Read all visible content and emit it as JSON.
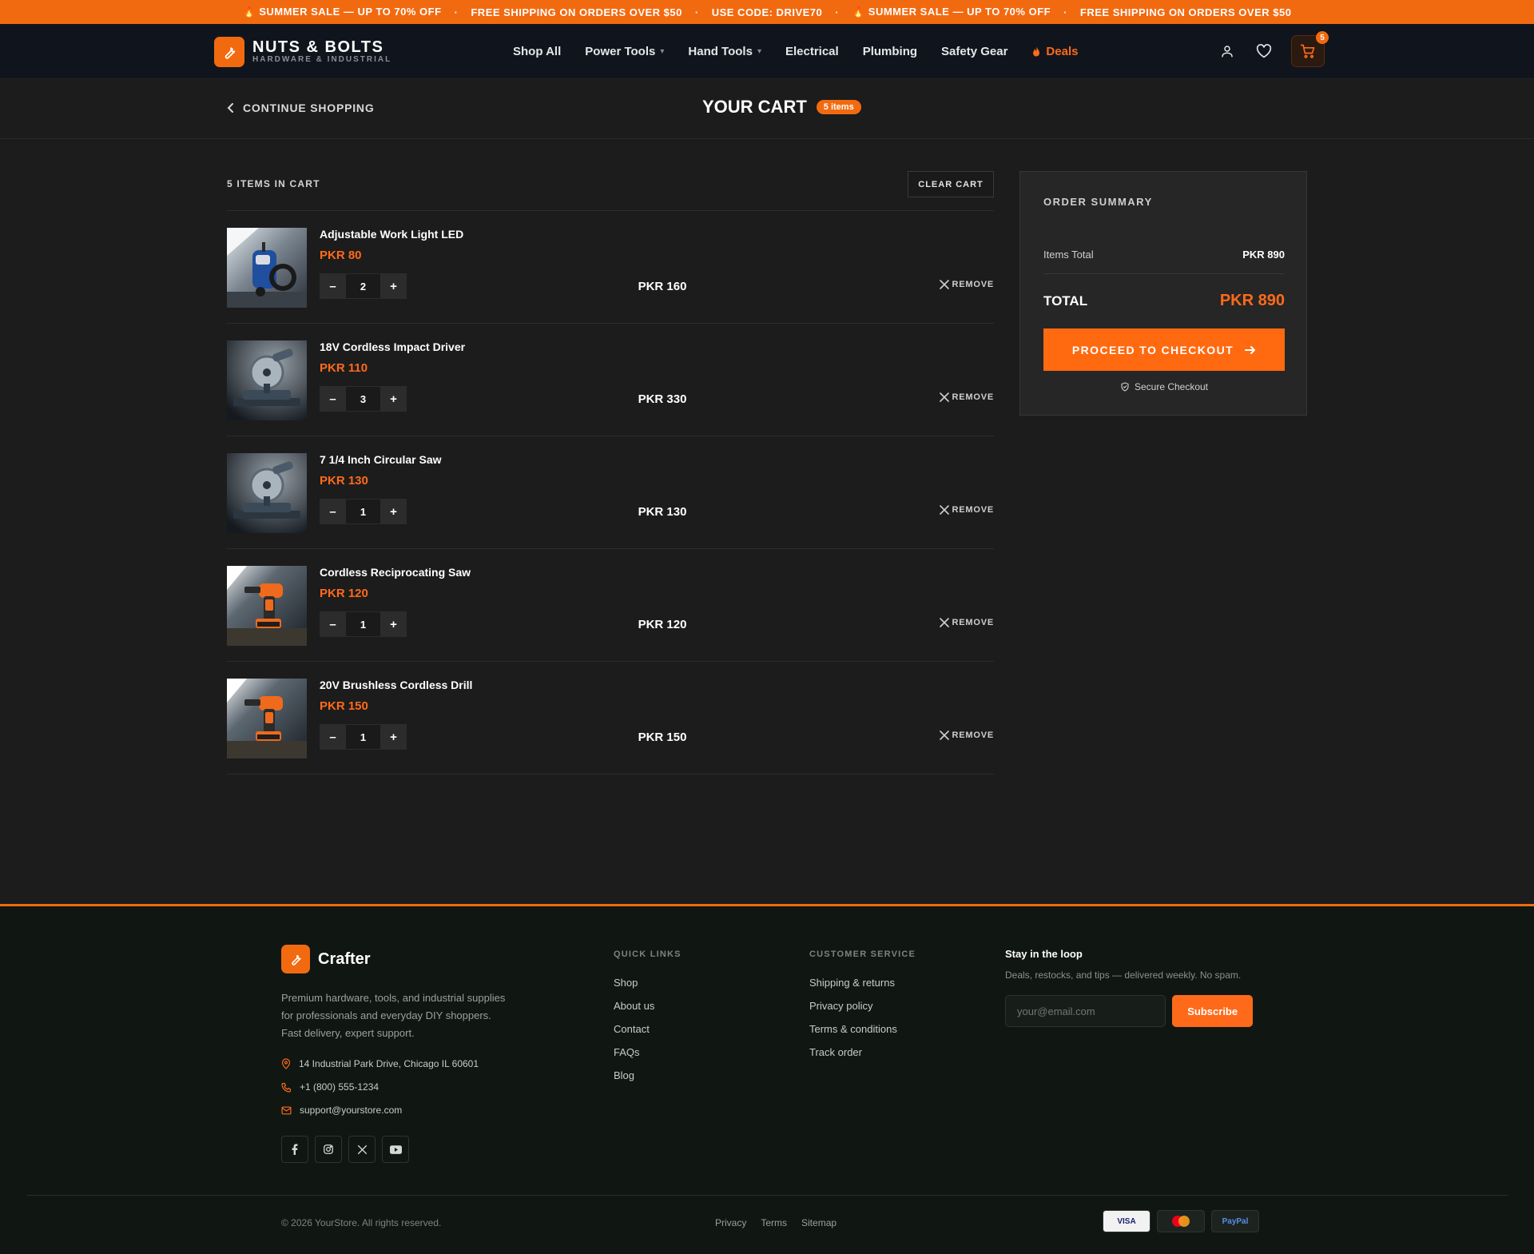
{
  "promo": {
    "items": [
      "SUMMER SALE — UP TO 70% OFF",
      "FREE SHIPPING ON ORDERS OVER $50",
      "USE CODE: DRIVE70",
      "SUMMER SALE — UP TO 70% OFF",
      "FREE SHIPPING ON ORDERS OVER $50"
    ]
  },
  "brand": {
    "name": "NUTS & BOLTS",
    "tagline": "HARDWARE & INDUSTRIAL"
  },
  "nav": {
    "items": [
      "Shop All",
      "Power Tools",
      "Hand Tools",
      "Electrical",
      "Plumbing",
      "Safety Gear",
      "Deals"
    ]
  },
  "header": {
    "cart_count": "5"
  },
  "cart": {
    "continue_label": "CONTINUE SHOPPING",
    "title": "YOUR CART",
    "badge": "5 items",
    "items_label": "5 ITEMS IN CART",
    "clear_label": "CLEAR CART",
    "remove_label": "REMOVE",
    "items": [
      {
        "name": "Adjustable Work Light LED",
        "price": "PKR 80",
        "qty": "2",
        "total": "PKR 160",
        "image": "pressure-washer"
      },
      {
        "name": "18V Cordless Impact Driver",
        "price": "PKR 110",
        "qty": "3",
        "total": "PKR 330",
        "image": "miter-saw"
      },
      {
        "name": "7 1/4 Inch Circular Saw",
        "price": "PKR 130",
        "qty": "1",
        "total": "PKR 130",
        "image": "miter-saw"
      },
      {
        "name": "Cordless Reciprocating Saw",
        "price": "PKR 120",
        "qty": "1",
        "total": "PKR 120",
        "image": "orange-drill"
      },
      {
        "name": "20V Brushless Cordless Drill",
        "price": "PKR 150",
        "qty": "1",
        "total": "PKR 150",
        "image": "orange-drill"
      }
    ]
  },
  "summary": {
    "title": "ORDER SUMMARY",
    "items_total_label": "Items Total",
    "items_total_value": "PKR 890",
    "total_label": "TOTAL",
    "total_value": "PKR 890",
    "checkout_label": "PROCEED TO CHECKOUT",
    "secure_label": "Secure Checkout"
  },
  "footer": {
    "brand": "Crafter",
    "description": "Premium hardware, tools, and industrial supplies for professionals and everyday DIY shoppers. Fast delivery, expert support.",
    "address": "14 Industrial Park Drive, Chicago IL 60601",
    "phone": "+1 (800) 555-1234",
    "email": "support@yourstore.com",
    "quick_links_title": "QUICK LINKS",
    "quick_links": [
      "Shop",
      "About us",
      "Contact",
      "FAQs",
      "Blog"
    ],
    "service_title": "CUSTOMER SERVICE",
    "service_links": [
      "Shipping & returns",
      "Privacy policy",
      "Terms & conditions",
      "Track order"
    ],
    "newsletter_title": "Stay in the loop",
    "newsletter_text": "Deals, restocks, and tips — delivered weekly. No spam.",
    "newsletter_placeholder": "your@email.com",
    "subscribe_label": "Subscribe",
    "copyright": "© 2026 YourStore. All rights reserved.",
    "legal": [
      "Privacy",
      "Terms",
      "Sitemap"
    ],
    "payments": [
      "VISA",
      "mastercard",
      "PayPal"
    ]
  },
  "colors": {
    "accent": "#f26a10",
    "background": "#1c1c1c",
    "footer": "#101713"
  }
}
